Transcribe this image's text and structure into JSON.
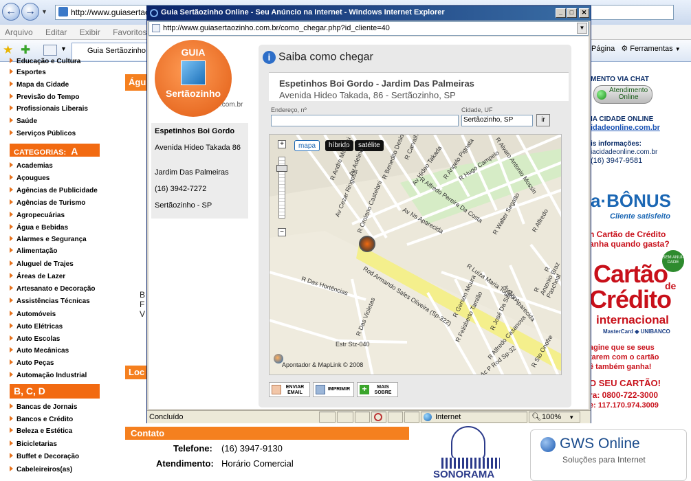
{
  "browser": {
    "address": "http://www.guiasertao",
    "menu": [
      "Arquivo",
      "Editar",
      "Exibir",
      "Favoritos"
    ],
    "tab_label": "Guia Sertãozinho -",
    "tools": {
      "page": "Página",
      "tools": "Ferramentas"
    }
  },
  "left_nav": {
    "items_top": [
      "Educação e Cultura",
      "Esportes",
      "Mapa da Cidade",
      "Previsão do Tempo",
      "Profissionais Liberais",
      "Saúde",
      "Serviços Públicos"
    ],
    "cat_a_header": "CATEGORIAS:",
    "cat_a_letter": "A",
    "items_a": [
      "Academias",
      "Açougues",
      "Agências de Publicidade",
      "Agências de Turismo",
      "Agropecuárias",
      "Água e Bebidas",
      "Alarmes e Segurança",
      "Alimentação",
      "Aluguel de Trajes",
      "Áreas de Lazer",
      "Artesanato e Decoração",
      "Assistências Técnicas",
      "Automóveis",
      "Auto Elétricas",
      "Auto Escolas",
      "Auto Mecânicas",
      "Auto Peças",
      "Automação Industrial"
    ],
    "cat_bcd_header": "B, C, D",
    "items_bcd": [
      "Bancas de Jornais",
      "Bancos e Crédito",
      "Beleza e Estética",
      "Bicicletarias",
      "Buffet e Decoração",
      "Cabeleireiros(as)"
    ]
  },
  "main": {
    "agua_bar": "Águ",
    "loc_bar": "Loc",
    "side_letters": [
      "B",
      "F",
      "V"
    ],
    "contato_label": "Contato",
    "telefone_label": "Telefone:",
    "telefone_value": "(16) 3947-9130",
    "atendimento_label": "Atendimento:",
    "atendimento_value": "Horário Comercial"
  },
  "right_col": {
    "chat_title": "MENTO VIA CHAT",
    "chat_btn_line1": "Atendimento",
    "chat_btn_line2": "Online",
    "cidade_title": "IA CIDADE ONLINE",
    "cidade_link": "idadeonline.com.br",
    "info_title": "is informações:",
    "info_email": "iacidadeonline.com.br",
    "info_phone": "(16) 3947-9581",
    "bonus_title": "a·BÔNUS",
    "bonus_sub": "Cliente satisfeito",
    "ad_line1": "n Cartão de Crédito",
    "ad_line2": "anha quando gasta?",
    "ad_big1": "Cartão",
    "ad_big_de": "de",
    "ad_big2": "Crédito",
    "ad_big3": "internacional",
    "ad_badge": "SEM ANUI-DADE",
    "ad_brands": "MasterCard ◆ UNIBANCO",
    "ad_line3": "agine que se seus",
    "ad_line4": "tarem com o cartão",
    "ad_line5": "ê também ganha!",
    "ad_line6": "O SEU CARTÃO!",
    "ad_line7": "ra: 0800-722-3000",
    "ad_line8": "e: 117.170.974.3009",
    "gws_title": "GWS Online",
    "gws_sub": "Soluções para Internet",
    "sonorama": "SONORAMA"
  },
  "popup": {
    "title": "Guia Sertãozinho Online - Seu Anúncio na Internet - Windows Internet Explorer",
    "address": "http://www.guiasertaozinho.com.br/como_chegar.php?id_cliente=40",
    "logo_guia": "GUIA",
    "logo_name": "Sertãozinho",
    "logo_dom": ".com.br",
    "card_name": "Espetinhos Boi Gordo",
    "card_address": "Avenida Hideo Takada 86",
    "card_district": "Jardim Das Palmeiras",
    "card_phone": "(16) 3942-7272",
    "card_city": "Sertãozinho - SP",
    "panel_title": "Saiba como chegar",
    "biz_title": "Espetinhos Boi Gordo - Jardim Das Palmeiras",
    "biz_address": "Avenida Hideo Takada, 86 - Sertãozinho, SP",
    "form_endereco_label": "Endereço, nº",
    "form_cidade_label": "Cidade, UF",
    "form_endereco_value": "",
    "form_cidade_value": "Sertãozinho, SP",
    "form_go": "ir",
    "map_btns": [
      "mapa",
      "híbrido",
      "satélite"
    ],
    "map_credit": "Apontador & MapLink © 2008",
    "street_labels": [
      "R Andre Marucci",
      "Av Cezar Ringossi",
      "Av Adelino",
      "R Benedito Desiderio",
      "R Carvalho",
      "Av Hideo Takada",
      "R Angelo Pignata",
      "R Hugo Campelo",
      "R Alvaro Antonio Mossin",
      "Av Ns Aparecida",
      "R Alfredo Pereira Da Costa",
      "R Walter Segatto",
      "R Alfredo",
      "R Orolano Castelani",
      "R Das Hortências",
      "Rod Armando Sales Oliveira (Sp-322)",
      "R Das Violetas",
      "Estr Stz-040",
      "R Luiza Maria Tognon",
      "R Gerson Moura",
      "R Felisberto Tamião",
      "R José Da Silva",
      "R Alfredo Casanova",
      "Av Ns Aparecida",
      "Ac P Rod Sp-32",
      "R Sto Onofre",
      "R Antonio Paschoal",
      "R Braz"
    ],
    "actions": [
      {
        "l1": "ENVIAR",
        "l2": "EMAIL"
      },
      {
        "l1": "IMPRIMIR",
        "l2": ""
      },
      {
        "l1": "MAIS",
        "l2": "SOBRE"
      }
    ],
    "status": "Concluído",
    "zone": "Internet",
    "zoom": "100%"
  }
}
